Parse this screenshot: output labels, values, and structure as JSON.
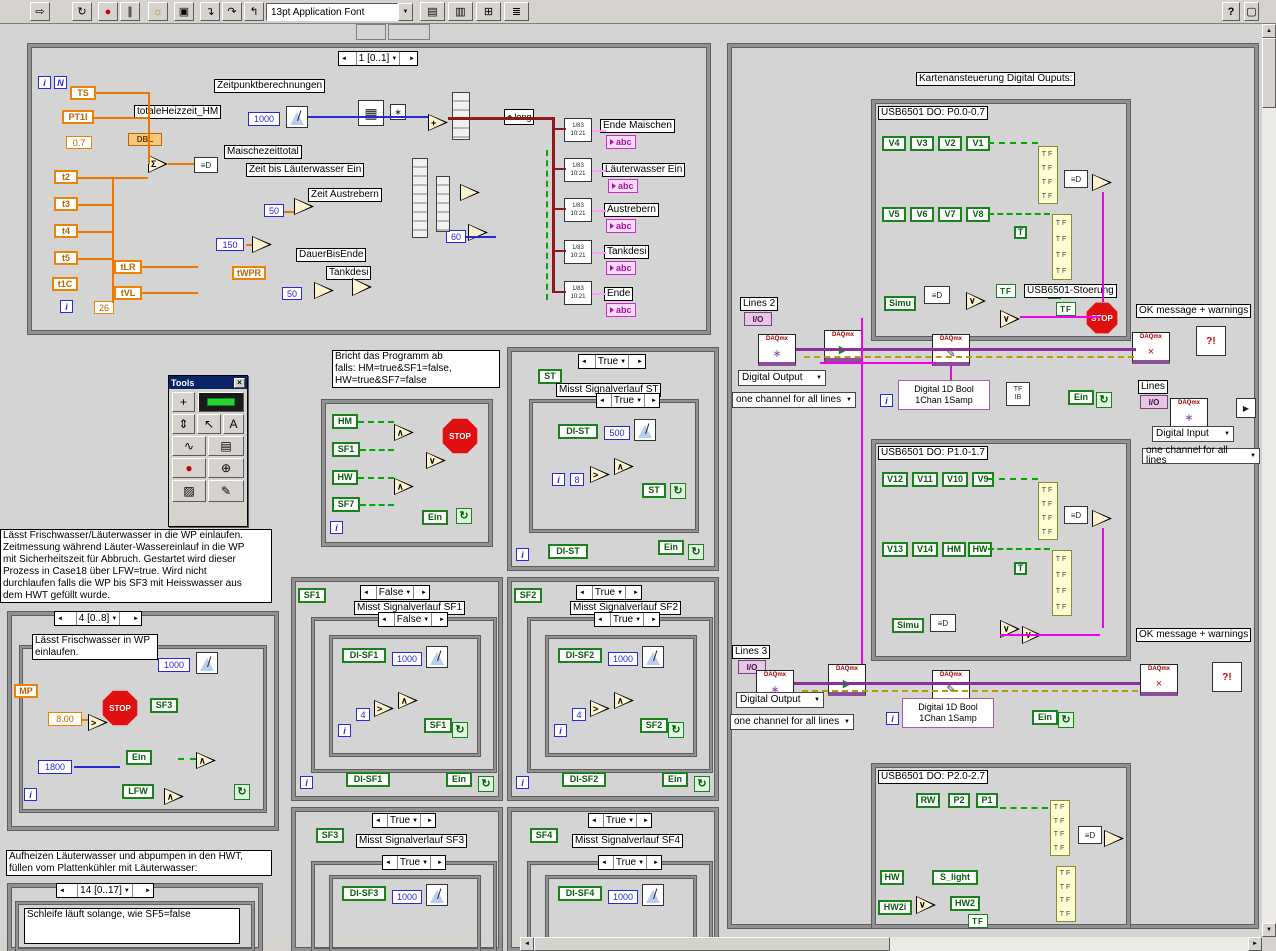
{
  "sym": {
    "i": "i",
    "n": "N",
    "and": "∧",
    "or": "∨",
    "sum": "Σ",
    "gt": ">",
    "plus": "+",
    "eqd": "≡D",
    "tf": "TF",
    "ib": "IB",
    "t": "T",
    "abc": "abc",
    "dbl": "DBL",
    "io": "I/O",
    "daqmx": "DAQmx",
    "down": "▼",
    "left": "◄",
    "right": "►",
    "up": "▲",
    "stop": "STOP",
    "play": "▶",
    "loop": "↻",
    "err": "?!",
    "long": "long",
    "diamond": "◆",
    "fmt_top": "1/83",
    "fmt_bot": "10:21",
    "cal": "▦",
    "star": "∗",
    "pencil": "✎",
    "clear": "×",
    "q": "?"
  },
  "toolbar": {
    "font": "13pt Application Font",
    "icons": {
      "run": "⇨",
      "run_cont": "↻",
      "abort": "●",
      "pause": "∥",
      "highlight": "☼",
      "retain": "▣",
      "step_into": "↴",
      "step_over": "↷",
      "step_out": "↰",
      "align": "▤",
      "distribute": "▥",
      "resize": "⊞",
      "reorder": "≣",
      "help": "?",
      "context": "▢"
    }
  },
  "tools": {
    "title": "Tools",
    "close": "×",
    "icons": {
      "operate": "+",
      "scroll": "⇕",
      "position": "↖",
      "label": "A",
      "wire": "∿",
      "popup": "▤",
      "breakpoint": "●",
      "probe": "⊕",
      "color_copy": "▨",
      "color": "✎"
    }
  },
  "seq1": {
    "header": "1 [0..1]",
    "captions": [
      "Zeitpunktberechnungen",
      "totaleHeizzeit_HM",
      "Maischezeittotal",
      "Zeit bis Läuterwasser Ein",
      "Zeit Austrebern",
      "DauerBisEnde",
      "Tankdesi"
    ],
    "terminals": [
      "TS",
      "PT1l",
      "t2",
      "t3",
      "t4",
      "t5",
      "t1C",
      "tLR",
      "tVL",
      "tWPR"
    ],
    "const_07": "0.7",
    "const_26": "26",
    "blue": [
      "1000",
      "50",
      "150",
      "50",
      "60"
    ],
    "outputs": [
      "Ende Maischen",
      "Läuterwasser Ein",
      "Austrebern",
      "Tankdesi",
      "Ende"
    ]
  },
  "abort": {
    "comment": "Bricht das Programm ab\nfalls: HM=true&SF1=false,\nHW=true&SF7=false",
    "terms": [
      "HM",
      "SF1",
      "HW",
      "SF7"
    ],
    "ein": "Ein"
  },
  "note_wp": "Lässt Frischwasser/Läuterwasser in die WP einlaufen.\nZeitmessung während Läuter-Wassereinlauf in die WP\nmit Sicherheitszeit für Abbruch. Gestartet wird dieser\nProzess in Case18 über LFW=true. Wird nicht\ndurchlaufen falls die WP bis SF3 mit Heisswasser aus\ndem HWT gefüllt wurde.",
  "case4": {
    "header": "4 [0..8]",
    "caption": "Lässt Frischwasser in WP einlaufen.",
    "mp": "MP",
    "v8": "8.00",
    "v1000": "1000",
    "v1800": "1800",
    "sf3": "SF3",
    "ein": "Ein",
    "lfw": "LFW"
  },
  "panels": [
    {
      "term": "ST",
      "sel": "True",
      "title": "Misst Signalverlauf ST",
      "inner_sel": "True",
      "di": "DI-ST",
      "wait": "500",
      "cmp": "8",
      "ein": "Ein"
    },
    {
      "term": "SF1",
      "sel": "False",
      "title": "Misst Signalverlauf SF1",
      "inner_sel": "False",
      "di": "DI-SF1",
      "wait": "1000",
      "cmp": "4",
      "ein": "Ein"
    },
    {
      "term": "SF2",
      "sel": "True",
      "title": "Misst Signalverlauf SF2",
      "inner_sel": "True",
      "di": "DI-SF2",
      "wait": "1000",
      "cmp": "4",
      "ein": "Ein"
    },
    {
      "term": "SF3",
      "sel": "True",
      "title": "Misst Signalverlauf SF3",
      "inner_sel": "True",
      "di": "DI-SF3",
      "wait": "1000"
    },
    {
      "term": "SF4",
      "sel": "True",
      "title": "Misst Signalverlauf SF4",
      "inner_sel": "True",
      "di": "DI-SF4",
      "wait": "1000"
    }
  ],
  "right": {
    "title": "Kartenansteuerung Digital Ouputs:",
    "frames": [
      {
        "title": "USB6501 DO: P0.0-0.7",
        "row1": [
          "V4",
          "V3",
          "V2",
          "V1"
        ],
        "row2": [
          "V5",
          "V6",
          "V7",
          "V8"
        ],
        "simu": "Simu",
        "note": "USB6501-Stoerung"
      },
      {
        "title": "USB6501 DO: P1.0-1.7",
        "row1": [
          "V12",
          "V11",
          "V10",
          "V9"
        ],
        "row2": [
          "V13",
          "V14",
          "HM",
          "HW"
        ],
        "simu": "Simu"
      },
      {
        "title": "USB6501 DO: P2.0-2.7",
        "row1": [
          "RW",
          "P2",
          "P1"
        ],
        "hw": "HW",
        "s_light": "S_light",
        "hw2i": "HW2i",
        "hw2": "HW2"
      }
    ],
    "rows": [
      {
        "lines": "Lines 2",
        "mode": "Digital Output",
        "channel": "one channel for all lines",
        "dtype1": "Digital 1D Bool",
        "dtype2": "1Chan 1Samp",
        "ein": "Ein",
        "ok": "OK message + warnings",
        "lines_b": "Lines",
        "mode_b": "Digital Input",
        "channel_b": "one channel for all lines"
      },
      {
        "lines": "Lines 3",
        "mode": "Digital Output",
        "channel": "one channel for all lines",
        "dtype1": "Digital 1D Bool",
        "dtype2": "1Chan 1Samp",
        "ein": "Ein",
        "ok": "OK message + warnings"
      }
    ]
  },
  "bottom": {
    "note": "Aufheizen Läuterwasser und abpumpen in den HWT,\nfüllen vom Plattenkühler mit Läuterwasser:",
    "header": "14 [0..17]",
    "caption": "Schleife läuft solange, wie SF5=false"
  }
}
